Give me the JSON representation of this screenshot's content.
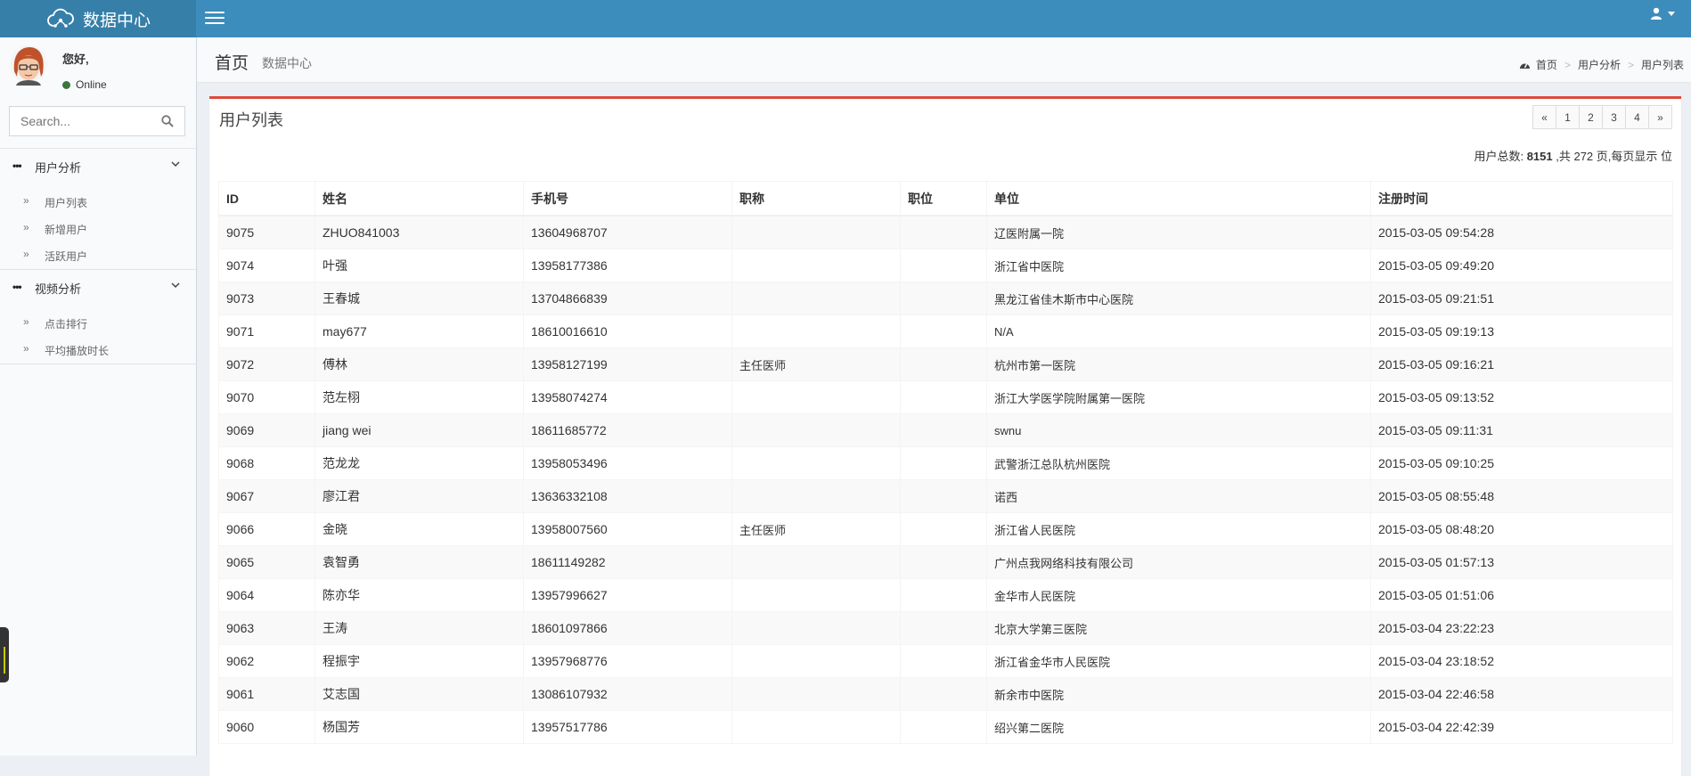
{
  "header": {
    "app_title": "数据中心"
  },
  "sidebar": {
    "greeting": "您好,",
    "status": "Online",
    "search_placeholder": "Search...",
    "groups": [
      {
        "label": "用户分析",
        "items": [
          "用户列表",
          "新增用户",
          "活跃用户"
        ]
      },
      {
        "label": "视频分析",
        "items": [
          "点击排行",
          "平均播放时长"
        ]
      }
    ]
  },
  "content_header": {
    "title": "首页",
    "subtitle": "数据中心",
    "breadcrumb": [
      "首页",
      "用户分析",
      "用户列表"
    ]
  },
  "box": {
    "title": "用户列表",
    "pagination": [
      "«",
      "1",
      "2",
      "3",
      "4",
      "»"
    ],
    "summary_prefix": "用户总数:",
    "total_users": "8151",
    "summary_suffix": ",共 272 页,每页显示 位"
  },
  "table": {
    "columns": [
      "ID",
      "姓名",
      "手机号",
      "职称",
      "职位",
      "单位",
      "注册时间"
    ],
    "rows": [
      [
        "9075",
        "ZHUO841003",
        "13604968707",
        "",
        "",
        "辽医附属一院",
        "2015-03-05 09:54:28"
      ],
      [
        "9074",
        "叶强",
        "13958177386",
        "",
        "",
        "浙江省中医院",
        "2015-03-05 09:49:20"
      ],
      [
        "9073",
        "王春城",
        "13704866839",
        "",
        "",
        "黑龙江省佳木斯市中心医院",
        "2015-03-05 09:21:51"
      ],
      [
        "9071",
        "may677",
        "18610016610",
        "",
        "",
        "N/A",
        "2015-03-05 09:19:13"
      ],
      [
        "9072",
        "傅林",
        "13958127199",
        "主任医师",
        "",
        "杭州市第一医院",
        "2015-03-05 09:16:21"
      ],
      [
        "9070",
        "范左栩",
        "13958074274",
        "",
        "",
        "浙江大学医学院附属第一医院",
        "2015-03-05 09:13:52"
      ],
      [
        "9069",
        "jiang wei",
        "18611685772",
        "",
        "",
        "swnu",
        "2015-03-05 09:11:31"
      ],
      [
        "9068",
        "范龙龙",
        "13958053496",
        "",
        "",
        "武警浙江总队杭州医院",
        "2015-03-05 09:10:25"
      ],
      [
        "9067",
        "廖江君",
        "13636332108",
        "",
        "",
        "诺西",
        "2015-03-05 08:55:48"
      ],
      [
        "9066",
        "金晓",
        "13958007560",
        "主任医师",
        "",
        "浙江省人民医院",
        "2015-03-05 08:48:20"
      ],
      [
        "9065",
        "袁智勇",
        "18611149282",
        "",
        "",
        "广州点我网络科技有限公司",
        "2015-03-05 01:57:13"
      ],
      [
        "9064",
        "陈亦华",
        "13957996627",
        "",
        "",
        "金华市人民医院",
        "2015-03-05 01:51:06"
      ],
      [
        "9063",
        "王涛",
        "18601097866",
        "",
        "",
        "北京大学第三医院",
        "2015-03-04 23:22:23"
      ],
      [
        "9062",
        "程振宇",
        "13957968776",
        "",
        "",
        "浙江省金华市人民医院",
        "2015-03-04 23:18:52"
      ],
      [
        "9061",
        "艾志国",
        "13086107932",
        "",
        "",
        "新余市中医院",
        "2015-03-04 22:46:58"
      ],
      [
        "9060",
        "杨国芳",
        "13957517786",
        "",
        "",
        "绍兴第二医院",
        "2015-03-04 22:42:39"
      ]
    ]
  }
}
